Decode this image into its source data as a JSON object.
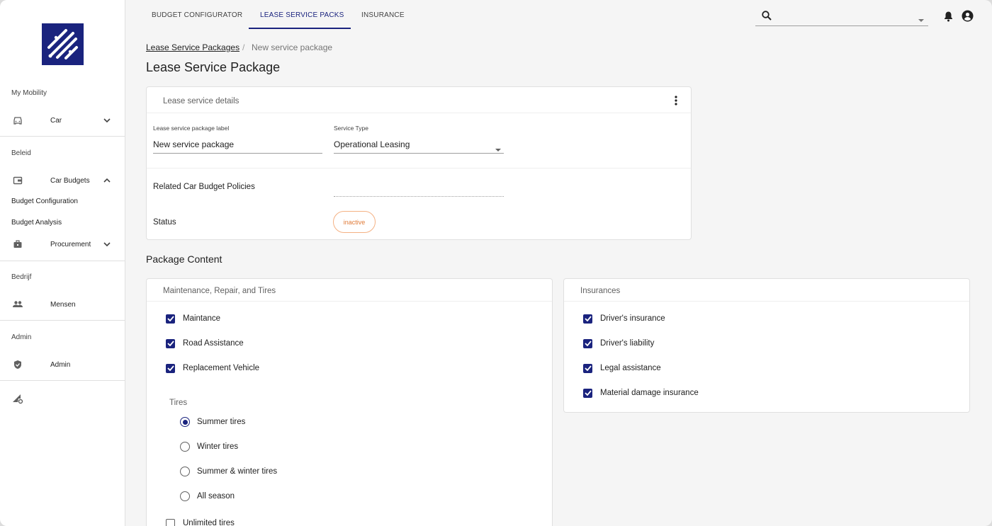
{
  "sidebar": {
    "sections": [
      {
        "title": "My Mobility"
      },
      {
        "title": "Beleid"
      },
      {
        "title": "Bedrijf"
      },
      {
        "title": "Admin"
      }
    ],
    "items": {
      "car": "Car",
      "car_budgets": "Car Budgets",
      "budget_configuration": "Budget Configuration",
      "budget_analysis": "Budget Analysis",
      "procurement": "Procurement",
      "mensen": "Mensen",
      "admin": "Admin"
    }
  },
  "nav": {
    "tabs": [
      "BUDGET CONFIGURATOR",
      "LEASE SERVICE PACKS",
      "INSURANCE"
    ],
    "active_tab": "LEASE SERVICE PACKS",
    "search_placeholder": ""
  },
  "breadcrumb": {
    "parent": "Lease Service Packages",
    "separator": "/",
    "current": "New service package"
  },
  "page_title": "Lease Service Package",
  "details_card": {
    "header": "Lease service details",
    "label_field": {
      "label": "Lease service package label",
      "value": "New service package"
    },
    "service_type": {
      "label": "Service Type",
      "value": "Operational Leasing"
    },
    "related_policies_label": "Related Car Budget Policies",
    "status_label": "Status",
    "status_value": "inactive"
  },
  "package_content": {
    "title": "Package Content",
    "maintenance": {
      "header": "Maintenance, Repair, and Tires",
      "items": [
        {
          "label": "Maintance",
          "checked": true
        },
        {
          "label": "Road Assistance",
          "checked": true
        },
        {
          "label": "Replacement Vehicle",
          "checked": true
        }
      ],
      "tires_label": "Tires",
      "tire_options": [
        {
          "label": "Summer tires",
          "selected": true
        },
        {
          "label": "Winter tires",
          "selected": false
        },
        {
          "label": "Summer & winter tires",
          "selected": false
        },
        {
          "label": "All season",
          "selected": false
        }
      ],
      "unlimited_tires": {
        "label": "Unlimited tires",
        "checked": false
      }
    },
    "insurances": {
      "header": "Insurances",
      "items": [
        {
          "label": "Driver's insurance",
          "checked": true
        },
        {
          "label": "Driver's liability",
          "checked": true
        },
        {
          "label": "Legal assistance",
          "checked": true
        },
        {
          "label": "Material damage insurance",
          "checked": true
        }
      ]
    }
  },
  "colors": {
    "accent": "#1a237e",
    "status_warning": "#e07b39"
  }
}
